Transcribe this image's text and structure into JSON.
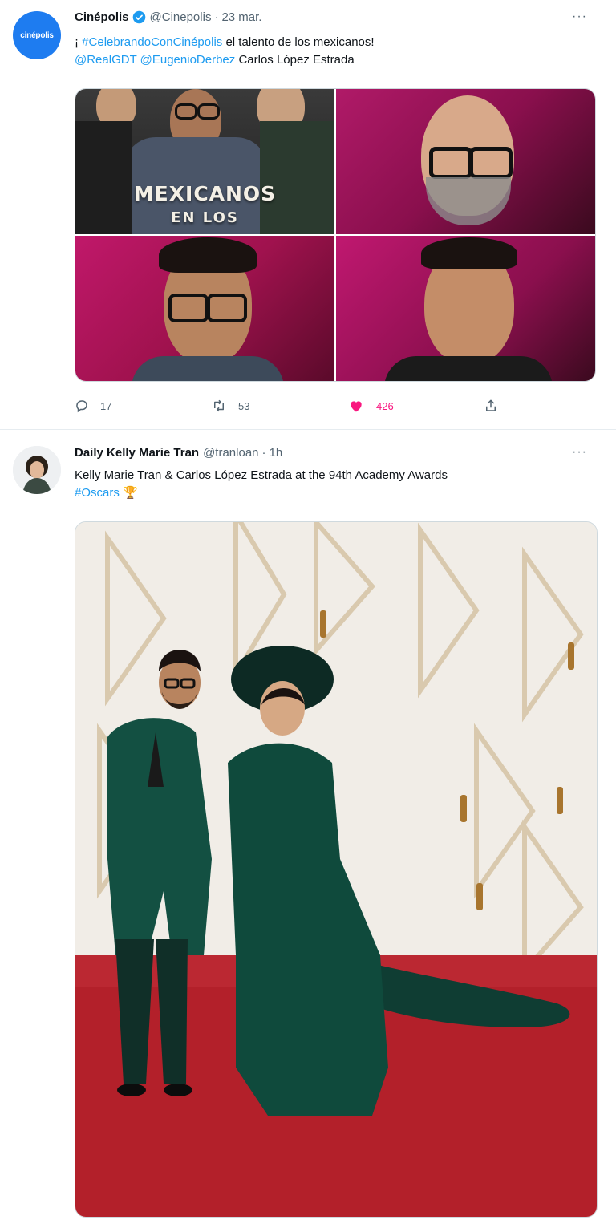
{
  "tweet1": {
    "avatar_text": "cinépolis",
    "name": "Cinépolis",
    "handle": "@Cinepolis",
    "dot": "·",
    "time": "23 mar.",
    "text_line1_prefix": "¡ ",
    "hashtag": "#CelebrandoConCinépolis",
    "text_line1_suffix": " el talento de los mexicanos!",
    "mention1": "@RealGDT",
    "mention2": "@EugenioDerbez",
    "text_line2_suffix": " Carlos López Estrada",
    "poster_line1": "MEXICANOS",
    "poster_line2": "EN LOS",
    "actions": {
      "reply_count": "17",
      "retweet_count": "53",
      "like_count": "426"
    },
    "more": "···"
  },
  "tweet2": {
    "name": "Daily Kelly Marie Tran",
    "handle": "@tranloan",
    "dot": "·",
    "time": "1h",
    "text_line1": "Kelly Marie Tran & Carlos López Estrada at the 94th Academy Awards",
    "hashtag": "#Oscars",
    "emoji": "🏆",
    "more": "···"
  },
  "colors": {
    "link": "#1d9bf0",
    "like": "#f91880",
    "muted": "#536471",
    "verified": "#1d9bf0"
  }
}
